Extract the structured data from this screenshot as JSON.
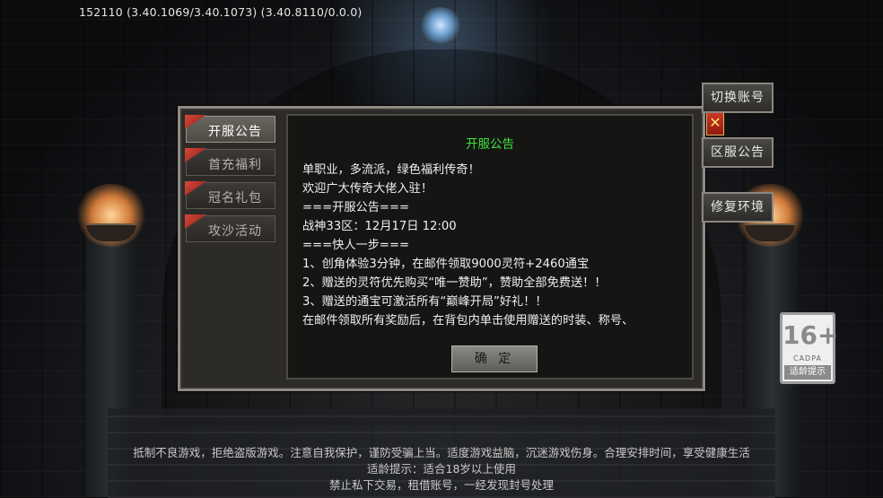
{
  "version_text": "152110 (3.40.1069/3.40.1073) (3.40.8110/0.0.0)",
  "tabs": [
    {
      "label": "开服公告",
      "active": true
    },
    {
      "label": "首充福利",
      "active": false
    },
    {
      "label": "冠名礼包",
      "active": false
    },
    {
      "label": "攻沙活动",
      "active": false
    }
  ],
  "notice": {
    "title": "开服公告",
    "lines": [
      "单职业，多流派，绿色福利传奇！",
      "欢迎广大传奇大佬入驻！",
      "===开服公告===",
      "战神33区：12月17日 12:00",
      "===快人一步===",
      "1、创角体验3分钟，在邮件领取9000灵符+2460通宝",
      "2、赠送的灵符优先购买“唯一赞助”，赞助全部免费送！！",
      "3、赠送的通宝可激活所有“巅峰开局”好礼！！",
      "在邮件领取所有奖励后，在背包内单击使用赠送的时装、称号、"
    ],
    "confirm_label": "确 定"
  },
  "close_label": "✕",
  "side_buttons": {
    "switch_account": "切换账号",
    "server_notice": "区服公告",
    "repair_env": "修复环境"
  },
  "age_badge": {
    "number": "16+",
    "org": "CADPA",
    "tip": "适龄提示"
  },
  "footer": {
    "line1": "抵制不良游戏，拒绝盗版游戏。注意自我保护，谨防受骗上当。适度游戏益脑，沉迷游戏伤身。合理安排时间，享受健康生活",
    "line2": "适龄提示：适合18岁以上使用",
    "line3": "禁止私下交易，租借账号，一经发现封号处理"
  },
  "colors": {
    "title_green": "#3fe13f",
    "close_red": "#d23a2a"
  }
}
